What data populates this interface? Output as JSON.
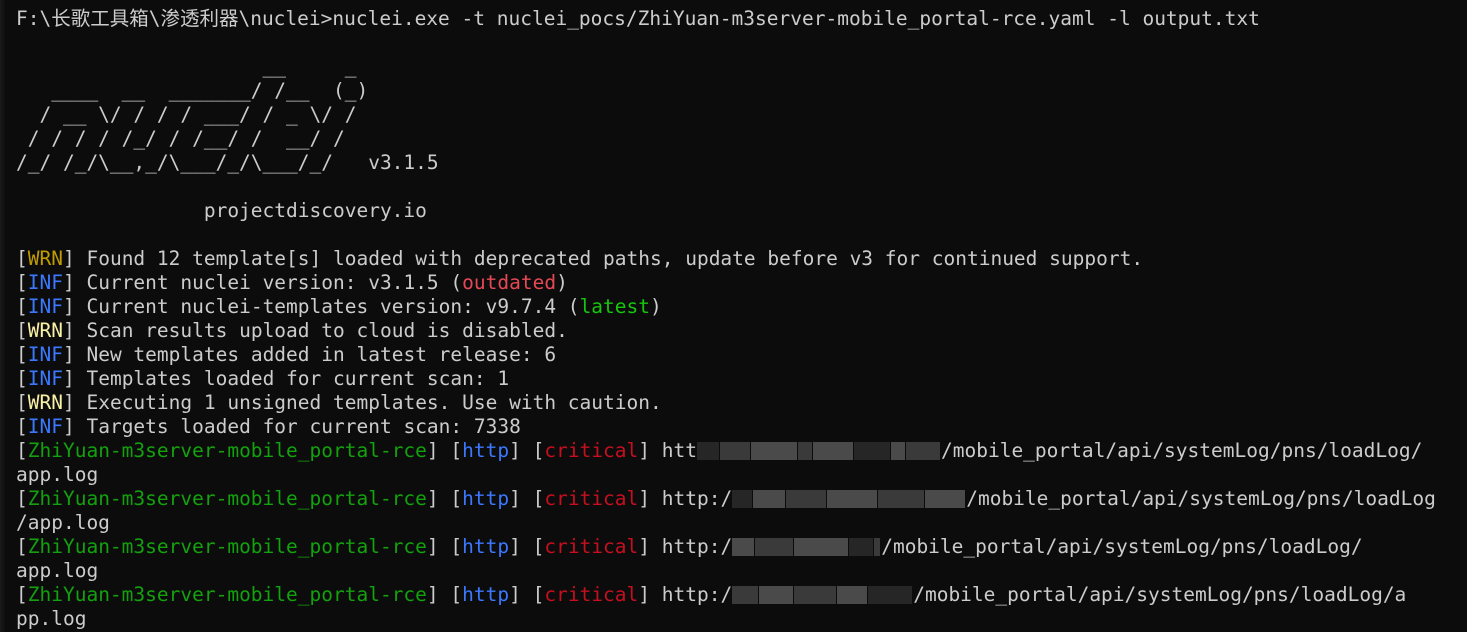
{
  "window": {
    "background": "#0c0c0c",
    "foreground": "#cccccc"
  },
  "command": {
    "prompt": "F:\\长歌工具箱\\渗透利器\\nuclei>",
    "text": "nuclei.exe -t nuclei_pocs/ZhiYuan-m3server-mobile_portal-rce.yaml -l output.txt"
  },
  "banner": {
    "art": "                     __     _\n   ____  __  _______/ /__  (_)\n  / __ \\/ / / / ___/ / _ \\/ /\n / / / / /_/ / /__/ /  __/ /\n/_/ /_/\\__,_/\\___/_/\\___/_/   v3.1.5",
    "site": "                projectdiscovery.io"
  },
  "log": [
    {
      "level": "WRN",
      "level_color": "#c19c00",
      "message": "Found 12 template[s] loaded with deprecated paths, update before v3 for continued support."
    },
    {
      "level": "INF",
      "level_color": "#3b78ff",
      "message": "Current nuclei version: v3.1.5 (",
      "tag": "outdated",
      "tag_color": "#e74856",
      "suffix": ")"
    },
    {
      "level": "INF",
      "level_color": "#3b78ff",
      "message": "Current nuclei-templates version: v9.7.4 (",
      "tag": "latest",
      "tag_color": "#16c60c",
      "suffix": ")"
    },
    {
      "level": "WRN",
      "level_color": "#f9f1a5",
      "message": "Scan results upload to cloud is disabled."
    },
    {
      "level": "INF",
      "level_color": "#3b78ff",
      "message": "New templates added in latest release: 6"
    },
    {
      "level": "INF",
      "level_color": "#3b78ff",
      "message": "Templates loaded for current scan: 1"
    },
    {
      "level": "WRN",
      "level_color": "#f9f1a5",
      "message": "Executing 1 unsigned templates. Use with caution."
    },
    {
      "level": "INF",
      "level_color": "#3b78ff",
      "message": "Targets loaded for current scan: 7338"
    }
  ],
  "results": [
    {
      "template": "ZhiYuan-m3server-mobile_portal-rce",
      "protocol": "http",
      "severity": "critical",
      "url_prefix": "htt",
      "url_suffix": "/mobile_portal/api/systemLog/pns/loadLog/",
      "url_wrap": "app.log"
    },
    {
      "template": "ZhiYuan-m3server-mobile_portal-rce",
      "protocol": "http",
      "severity": "critical",
      "url_prefix": "http:/",
      "url_suffix": "/mobile_portal/api/systemLog/pns/loadLog",
      "url_wrap": "/app.log"
    },
    {
      "template": "ZhiYuan-m3server-mobile_portal-rce",
      "protocol": "http",
      "severity": "critical",
      "url_prefix": "http:/",
      "url_suffix": "/mobile_portal/api/systemLog/pns/loadLog/",
      "url_wrap": "app.log"
    },
    {
      "template": "ZhiYuan-m3server-mobile_portal-rce",
      "protocol": "http",
      "severity": "critical",
      "url_prefix": "http:/",
      "url_suffix": "/mobile_portal/api/systemLog/pns/loadLog/a",
      "url_wrap": "pp.log"
    }
  ],
  "colors": {
    "template": "#13a10e",
    "protocol": "#3b78ff",
    "severity": "#c50f1f",
    "bracket": "#cccccc"
  }
}
